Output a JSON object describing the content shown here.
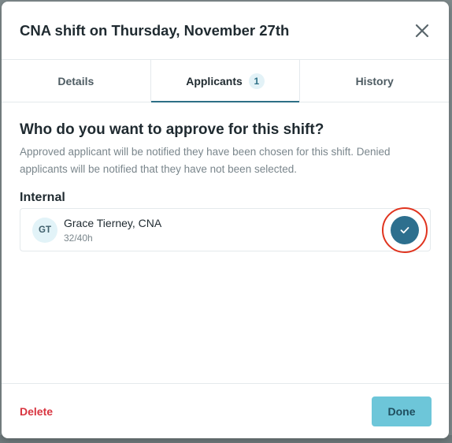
{
  "modal": {
    "title": "CNA shift on Thursday, November 27th"
  },
  "tabs": [
    {
      "label": "Details",
      "active": false
    },
    {
      "label": "Applicants",
      "badge": "1",
      "active": true
    },
    {
      "label": "History",
      "active": false
    }
  ],
  "content": {
    "question": "Who do you want to approve for this shift?",
    "help_text": "Approved applicant will be notified they have been chosen for this shift. Denied applicants will be notified that they have not been selected.",
    "section_label": "Internal",
    "applicants": [
      {
        "initials": "GT",
        "name": "Grace Tierney, CNA",
        "hours": "32/40h",
        "approved": true
      }
    ]
  },
  "footer": {
    "delete_label": "Delete",
    "done_label": "Done"
  },
  "colors": {
    "accent": "#2d6f8e",
    "done_button": "#6dc6d9",
    "delete_text": "#d8343f",
    "highlight_ring": "#e0341f"
  },
  "icons": {
    "close": "close-icon",
    "approve": "checkmark-icon"
  }
}
